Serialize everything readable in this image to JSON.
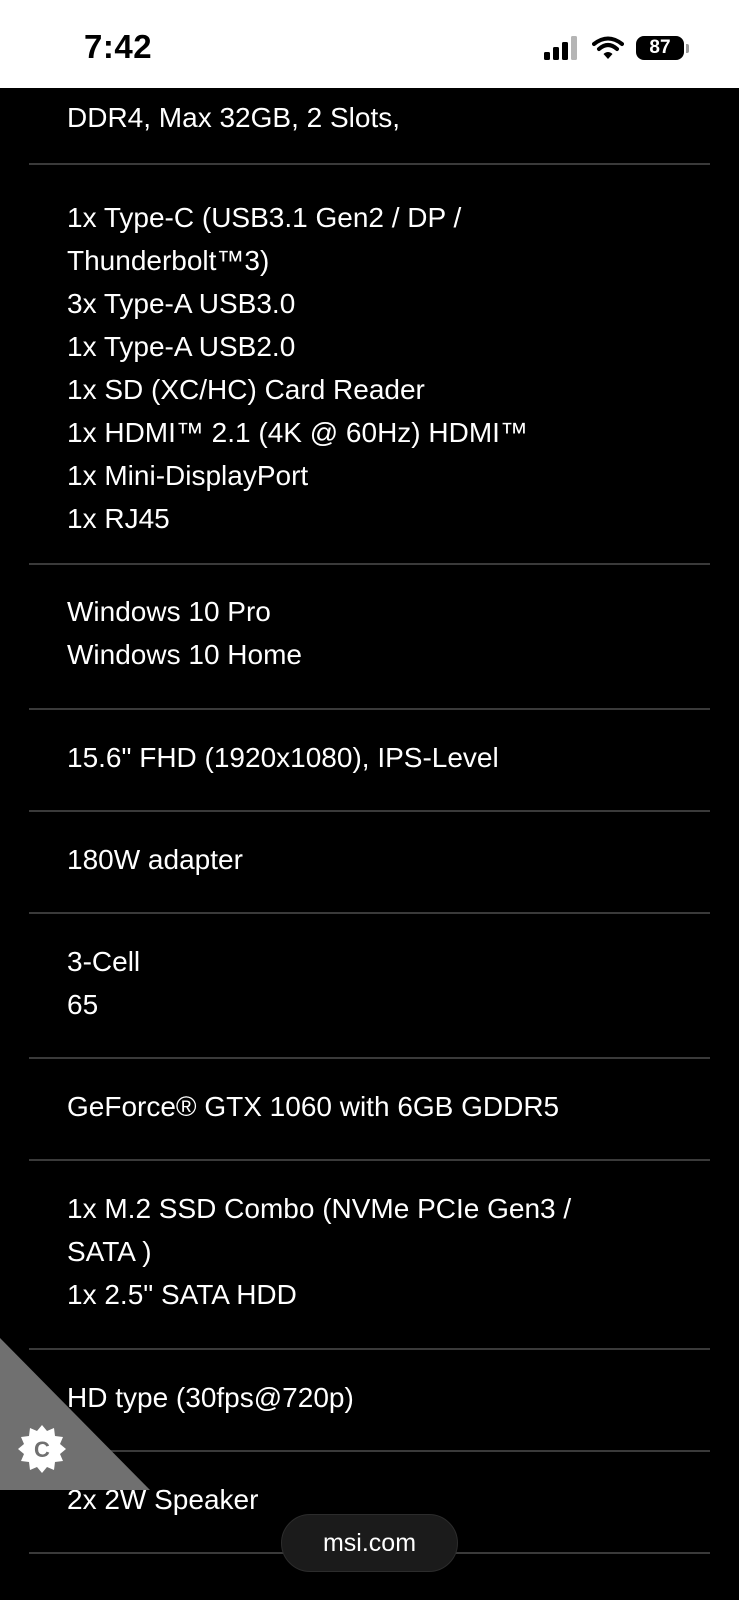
{
  "status_bar": {
    "time": "7:42",
    "battery": "87",
    "icons": [
      "signal-icon",
      "wifi-icon",
      "battery-icon"
    ]
  },
  "specs": [
    {
      "lines": [
        "DDR4, Max 32GB, 2 Slots,"
      ]
    },
    {
      "lines": [
        "1x Type-C (USB3.1 Gen2 / DP /",
        "Thunderbolt™3)",
        "3x Type-A USB3.0",
        "1x Type-A USB2.0",
        "1x SD (XC/HC) Card Reader",
        "1x HDMI™ 2.1 (4K @ 60Hz) HDMI™",
        "1x Mini-DisplayPort",
        "1x RJ45"
      ]
    },
    {
      "lines": [
        "Windows 10 Pro",
        "Windows 10 Home"
      ]
    },
    {
      "lines": [
        "15.6\" FHD (1920x1080), IPS-Level"
      ]
    },
    {
      "lines": [
        "180W adapter"
      ]
    },
    {
      "lines": [
        "3-Cell",
        "65"
      ]
    },
    {
      "lines": [
        "GeForce® GTX 1060 with 6GB GDDR5"
      ]
    },
    {
      "lines": [
        "1x M.2 SSD Combo (NVMe PCIe Gen3 /",
        "SATA )",
        "1x 2.5\" SATA HDD"
      ]
    },
    {
      "lines": [
        "HD type (30fps@720p)"
      ]
    },
    {
      "lines": [
        "2x 2W Speaker"
      ]
    }
  ],
  "cookie_widget": {
    "icon": "cookie-settings-icon",
    "letter": "C"
  },
  "browser": {
    "url": "msi.com"
  },
  "colors": {
    "background": "#000000",
    "text": "#ffffff",
    "divider": "#3a3a3a",
    "status_bar": "#ffffff"
  }
}
